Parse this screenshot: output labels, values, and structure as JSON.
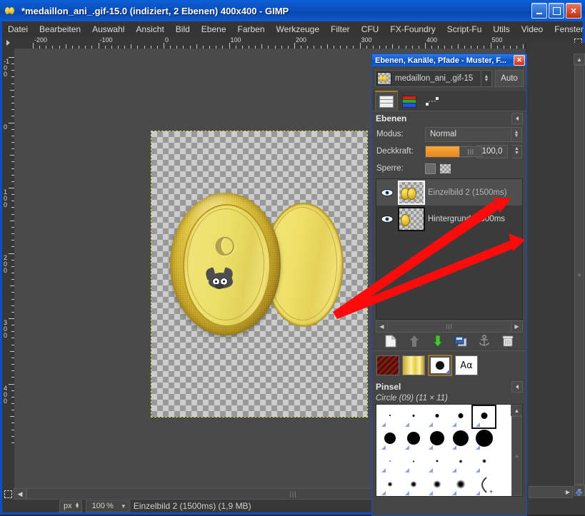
{
  "window": {
    "title": "*medaillon_ani_.gif-15.0 (indiziert, 2 Ebenen) 400x400 - GIMP",
    "minimize_label": "–",
    "maximize_label": "□",
    "close_label": "✕"
  },
  "menubar": {
    "items": [
      {
        "label": "Datei"
      },
      {
        "label": "Bearbeiten"
      },
      {
        "label": "Auswahl"
      },
      {
        "label": "Ansicht"
      },
      {
        "label": "Bild"
      },
      {
        "label": "Ebene"
      },
      {
        "label": "Farben"
      },
      {
        "label": "Werkzeuge"
      },
      {
        "label": "Filter"
      },
      {
        "label": "CFU"
      },
      {
        "label": "FX-Foundry"
      },
      {
        "label": "Script-Fu"
      },
      {
        "label": "Utils"
      },
      {
        "label": "Video"
      },
      {
        "label": "Fenster"
      }
    ]
  },
  "rulers": {
    "horizontal_labels": [
      "-200",
      "-100",
      "0",
      "100",
      "200",
      "300",
      "400",
      "500"
    ],
    "vertical_labels": [
      "-100",
      "0",
      "100",
      "200",
      "300",
      "400"
    ],
    "unit": "px"
  },
  "statusbar": {
    "unit": "px",
    "zoom": "100 %",
    "text": "Einzelbild 2 (1500ms) (1,9 MB)"
  },
  "dock": {
    "title": "Ebenen, Kanäle, Pfade - Muster, F...",
    "close_label": "✕",
    "image_selector": {
      "name": "medaillon_ani_.gif-15",
      "auto_label": "Auto"
    },
    "tabs": [
      {
        "name": "layers",
        "icon": "layers-icon",
        "active": true
      },
      {
        "name": "channels",
        "icon": "channels-icon",
        "active": false
      },
      {
        "name": "paths",
        "icon": "paths-icon",
        "active": false
      }
    ],
    "layers_section": {
      "title": "Ebenen",
      "mode_label": "Modus:",
      "mode_value": "Normal",
      "opacity_label": "Deckkraft:",
      "opacity_value": "100,0",
      "lock_label": "Sperre:",
      "rows": [
        {
          "name": "Einzelbild 2 (1500ms)",
          "visible": true,
          "selected": true
        },
        {
          "name": "Hintergrund (1000ms",
          "visible": true,
          "selected": false
        }
      ],
      "tools": [
        {
          "name": "new-layer-icon",
          "title": "Neue Ebene"
        },
        {
          "name": "raise-layer-icon",
          "title": "Ebene anheben"
        },
        {
          "name": "lower-layer-icon",
          "title": "Ebene absenken"
        },
        {
          "name": "duplicate-layer-icon",
          "title": "Ebene duplizieren"
        },
        {
          "name": "anchor-layer-icon",
          "title": "Ebene verankern"
        },
        {
          "name": "delete-layer-icon",
          "title": "Ebene löschen"
        }
      ]
    },
    "swatches": [
      {
        "name": "pattern-swatch"
      },
      {
        "name": "gradient-swatch"
      },
      {
        "name": "brush-swatch"
      },
      {
        "name": "font-swatch",
        "label": "Aα"
      }
    ],
    "brush_section": {
      "title": "Pinsel",
      "current": "Circle (09) (11 × 11)",
      "grid": [
        [
          {
            "size": 2
          },
          {
            "size": 3
          },
          {
            "size": 5
          },
          {
            "size": 7
          },
          {
            "size": 9,
            "selected": true
          }
        ],
        [
          {
            "size": 16
          },
          {
            "size": 18
          },
          {
            "size": 20
          },
          {
            "size": 22
          },
          {
            "size": 24
          }
        ],
        [
          {
            "size": 2,
            "fuzzy": true
          },
          {
            "size": 3,
            "fuzzy": true
          },
          {
            "size": 4,
            "fuzzy": true
          },
          {
            "size": 5,
            "fuzzy": true
          },
          {
            "size": 6,
            "fuzzy": true
          }
        ],
        [
          {
            "size": 7,
            "fuzzy": true
          },
          {
            "size": 9,
            "fuzzy": true
          },
          {
            "size": 11,
            "fuzzy": true
          },
          {
            "size": 13,
            "fuzzy": true
          },
          {
            "size": 0,
            "arc": true
          }
        ]
      ]
    }
  },
  "canvas": {
    "image_title": "medaillon_ani_.gif",
    "image_size": "400x400",
    "annotation": "rote Pfeile zeigen auf die Ebenen"
  }
}
